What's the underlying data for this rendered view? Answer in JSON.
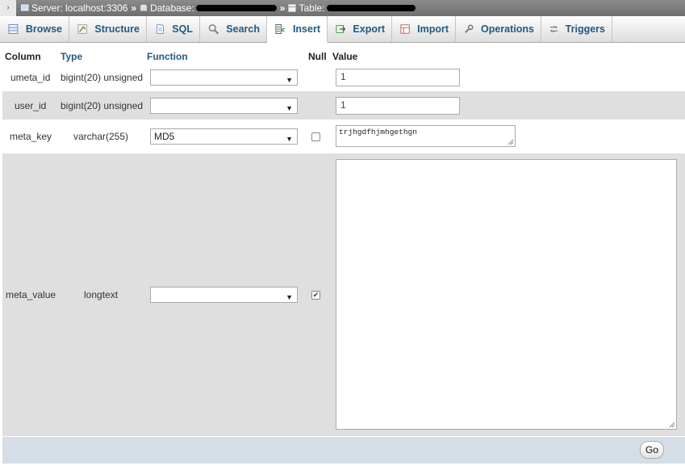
{
  "breadcrumb": {
    "server_label": "Server: localhost:3306",
    "database_label": "Database:",
    "table_label": "Table:",
    "separator": "»"
  },
  "tabs": [
    {
      "label": "Browse",
      "icon": "browse-icon",
      "active": false
    },
    {
      "label": "Structure",
      "icon": "structure-icon",
      "active": false
    },
    {
      "label": "SQL",
      "icon": "sql-icon",
      "active": false
    },
    {
      "label": "Search",
      "icon": "search-icon",
      "active": false
    },
    {
      "label": "Insert",
      "icon": "insert-icon",
      "active": true
    },
    {
      "label": "Export",
      "icon": "export-icon",
      "active": false
    },
    {
      "label": "Import",
      "icon": "import-icon",
      "active": false
    },
    {
      "label": "Operations",
      "icon": "wrench-icon",
      "active": false
    },
    {
      "label": "Triggers",
      "icon": "triggers-icon",
      "active": false
    }
  ],
  "columns": {
    "column": "Column",
    "type": "Type",
    "function": "Function",
    "null": "Null",
    "value": "Value"
  },
  "rows": [
    {
      "column": "umeta_id",
      "type": "bigint(20) unsigned",
      "function": "",
      "null_checked": null,
      "value": "1"
    },
    {
      "column": "user_id",
      "type": "bigint(20) unsigned",
      "function": "",
      "null_checked": null,
      "value": "1"
    },
    {
      "column": "meta_key",
      "type": "varchar(255)",
      "function": "MD5",
      "null_checked": false,
      "value": "trjhgdfhjmhgethgn"
    },
    {
      "column": "meta_value",
      "type": "longtext",
      "function": "",
      "null_checked": true,
      "value": ""
    }
  ],
  "footer": {
    "go_label": "Go"
  },
  "colors": {
    "link": "#235a81",
    "row_even": "#dfdfdf",
    "footer": "#d5dee6"
  }
}
